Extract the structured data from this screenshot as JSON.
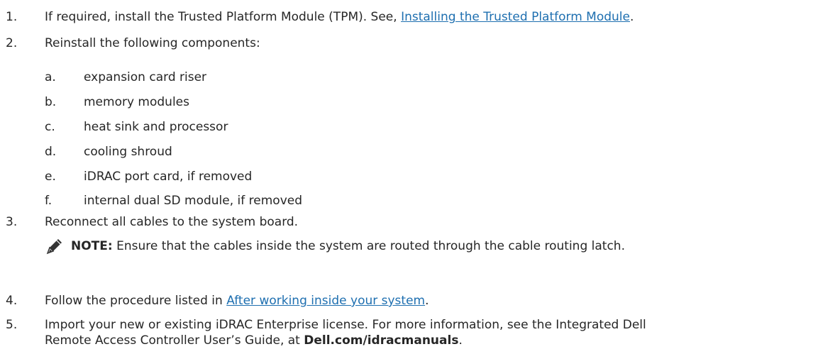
{
  "steps": [
    {
      "num": "1.",
      "text_before": "If required, install the Trusted Platform Module (TPM). See, ",
      "link": "Installing the Trusted Platform Module",
      "text_after": "."
    },
    {
      "num": "2.",
      "text": "Reinstall the following components:",
      "subitems": [
        {
          "letter": "a.",
          "text": "expansion card riser"
        },
        {
          "letter": "b.",
          "text": "memory modules"
        },
        {
          "letter": "c.",
          "text": "heat sink and processor"
        },
        {
          "letter": "d.",
          "text": "cooling shroud"
        },
        {
          "letter": "e.",
          "text": "iDRAC port card, if removed"
        },
        {
          "letter": "f.",
          "text": "internal dual SD module, if removed"
        }
      ]
    },
    {
      "num": "3.",
      "text": "Reconnect all cables to the system board.",
      "note": {
        "icon": "pencil-note-icon",
        "label": "NOTE:",
        "text": " Ensure that the cables inside the system are routed through the cable routing latch."
      }
    },
    {
      "num": "4.",
      "text_before": "Follow the procedure listed in ",
      "link": "After working inside your system",
      "text_after": "."
    },
    {
      "num": "5.",
      "line1": "Import your new or existing iDRAC Enterprise license. For more information, see the Integrated Dell",
      "line2_before": "Remote Access Controller User’s Guide, at ",
      "line2_bold": "Dell.com/idracmanuals",
      "line2_after": "."
    }
  ]
}
